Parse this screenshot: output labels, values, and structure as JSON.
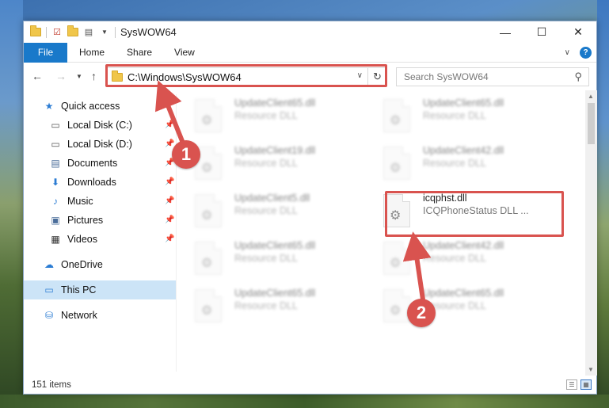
{
  "window": {
    "title": "SysWOW64",
    "controls": {
      "minimize": "—",
      "maximize": "☐",
      "close": "✕"
    }
  },
  "ribbon": {
    "tabs": [
      "File",
      "Home",
      "Share",
      "View"
    ],
    "help": "?"
  },
  "navigation": {
    "address": "C:\\Windows\\SysWOW64",
    "search_placeholder": "Search SysWOW64"
  },
  "sidebar": {
    "items": [
      {
        "label": "Quick access",
        "icon": "star-icon"
      },
      {
        "label": "Local Disk (C:)",
        "icon": "drive-icon"
      },
      {
        "label": "Local Disk (D:)",
        "icon": "drive-icon"
      },
      {
        "label": "Documents",
        "icon": "documents-icon"
      },
      {
        "label": "Downloads",
        "icon": "download-icon"
      },
      {
        "label": "Music",
        "icon": "music-icon"
      },
      {
        "label": "Pictures",
        "icon": "pictures-icon"
      },
      {
        "label": "Videos",
        "icon": "videos-icon"
      },
      {
        "label": "OneDrive",
        "icon": "cloud-icon"
      },
      {
        "label": "This PC",
        "icon": "computer-icon",
        "selected": true
      },
      {
        "label": "Network",
        "icon": "network-icon"
      }
    ]
  },
  "files": [
    {
      "name": "UpdateClient65.dll",
      "desc": "Resource DLL"
    },
    {
      "name": "UpdateClient65.dll",
      "desc": "Resource DLL"
    },
    {
      "name": "UpdateClient19.dll",
      "desc": "Resource DLL"
    },
    {
      "name": "UpdateClient42.dll",
      "desc": "Resource DLL"
    },
    {
      "name": "UpdateClient5.dll",
      "desc": "Resource DLL"
    },
    {
      "name": "icqphst.dll",
      "desc": "ICQPhoneStatus DLL ..."
    },
    {
      "name": "UpdateClient65.dll",
      "desc": "Resource DLL"
    },
    {
      "name": "UpdateClient42.dll",
      "desc": "Resource DLL"
    },
    {
      "name": "UpdateClient65.dll",
      "desc": "Resource DLL"
    },
    {
      "name": "UpdateClient65.dll",
      "desc": "Resource DLL"
    }
  ],
  "status": {
    "item_count": "151 items"
  },
  "callouts": {
    "one": "1",
    "two": "2"
  },
  "colors": {
    "accent": "#1979ca",
    "highlight": "#d9534f",
    "selected": "#cce4f7"
  }
}
